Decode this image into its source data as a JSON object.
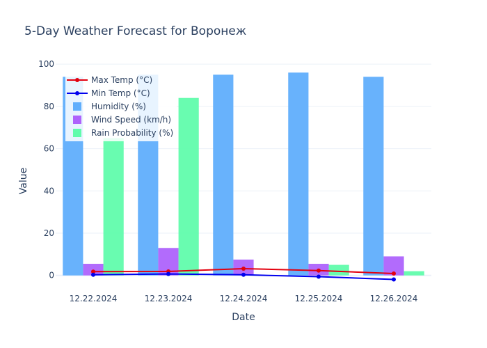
{
  "chart_data": {
    "type": "bar",
    "title": "5-Day Weather Forecast for Воронеж",
    "xlabel": "Date",
    "ylabel": "Value",
    "categories": [
      "12.22.2024",
      "12.23.2024",
      "12.24.2024",
      "12.25.2024",
      "12.26.2024"
    ],
    "ylim": [
      -8,
      104
    ],
    "yticks": [
      0,
      20,
      40,
      60,
      80,
      100
    ],
    "grid": true,
    "legend_position": "top-left",
    "bar_series": [
      {
        "name": "Humidity (%)",
        "color": "#60aefc",
        "values": [
          94,
          95,
          95,
          96,
          94
        ]
      },
      {
        "name": "Wind Speed (km/h)",
        "color": "#ae63fc",
        "values": [
          5.5,
          13,
          7.5,
          5.5,
          9
        ]
      },
      {
        "name": "Rain Probability (%)",
        "color": "#61fcac",
        "values": [
          65,
          84,
          0,
          5,
          2
        ]
      }
    ],
    "line_series": [
      {
        "name": "Max Temp (°C)",
        "color": "#e3000f",
        "values": [
          1.8,
          1.9,
          3.2,
          2.3,
          0.9
        ]
      },
      {
        "name": "Min Temp (°C)",
        "color": "#0000ee",
        "values": [
          0.3,
          0.7,
          0.3,
          -0.6,
          -1.9
        ]
      }
    ]
  }
}
